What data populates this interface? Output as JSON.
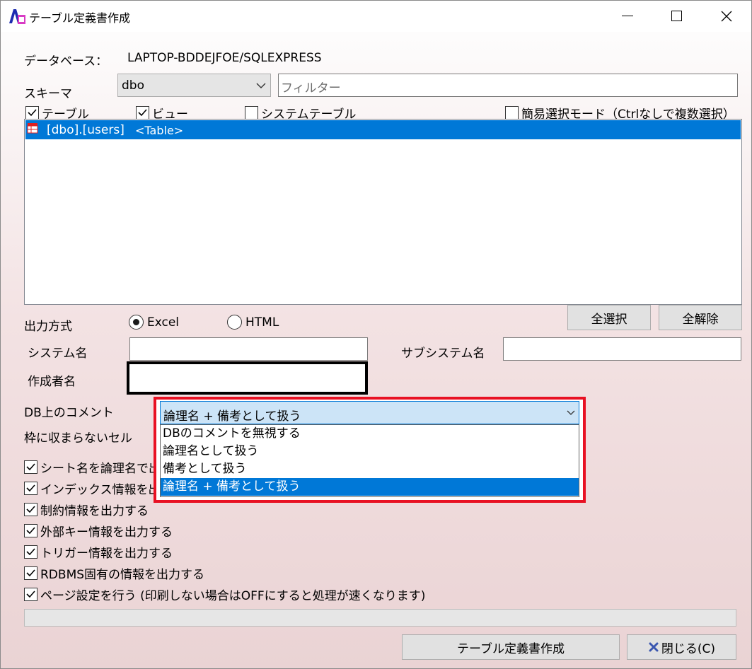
{
  "window": {
    "title": "テーブル定義書作成",
    "controls": {
      "minimize": "─",
      "maximize": "☐",
      "close": "✕"
    }
  },
  "database": {
    "label": "データベース：",
    "value": "LAPTOP-BDDEJFOE/SQLEXPRESS"
  },
  "schema": {
    "label": "スキーマ",
    "selected": "dbo",
    "filter_placeholder": "フィルター"
  },
  "object_filters": [
    {
      "label": "テーブル",
      "checked": true
    },
    {
      "label": "ビュー",
      "checked": true
    },
    {
      "label": "システムテーブル",
      "checked": false
    }
  ],
  "simple_select_mode": {
    "label": "簡易選択モード（Ctrlなしで複数選択）",
    "checked": false
  },
  "object_list": [
    {
      "name": "[dbo].[users]",
      "type": "<Table>",
      "selected": true
    }
  ],
  "buttons": {
    "select_all": "全選択",
    "deselect_all": "全解除",
    "create": "テーブル定義書作成",
    "close": "閉じる(C)"
  },
  "output": {
    "label": "出力方式",
    "options": [
      {
        "label": "Excel",
        "selected": true
      },
      {
        "label": "HTML",
        "selected": false
      }
    ]
  },
  "system_name": {
    "label": "システム名",
    "value": ""
  },
  "subsystem_name": {
    "label": "サブシステム名",
    "value": ""
  },
  "author_name": {
    "label": "作成者名",
    "value": ""
  },
  "db_comment": {
    "label": "DB上のコメント",
    "selected": "論理名 + 備考として扱う",
    "options": [
      "DBのコメントを無視する",
      "論理名として扱う",
      "備考として扱う",
      "論理名 + 備考として扱う"
    ],
    "highlighted_index": 3
  },
  "overflow_cell": {
    "label": "枠に収まらないセル"
  },
  "options": [
    {
      "label": "シート名を論理名で出",
      "checked": true
    },
    {
      "label": "インデックス情報を出力",
      "checked": true
    },
    {
      "label": "制約情報を出力する",
      "checked": true
    },
    {
      "label": "外部キー情報を出力する",
      "checked": true
    },
    {
      "label": "トリガー情報を出力する",
      "checked": true
    },
    {
      "label": "RDBMS固有の情報を出力する",
      "checked": true
    },
    {
      "label": "ページ設定を行う (印刷しない場合はOFFにすると処理が速くなります)",
      "checked": true
    }
  ],
  "progress": {
    "value": 0
  },
  "colors": {
    "selection": "#0078d7",
    "highlight_frame": "#e81123",
    "combo_focus": "#cce4f7"
  }
}
